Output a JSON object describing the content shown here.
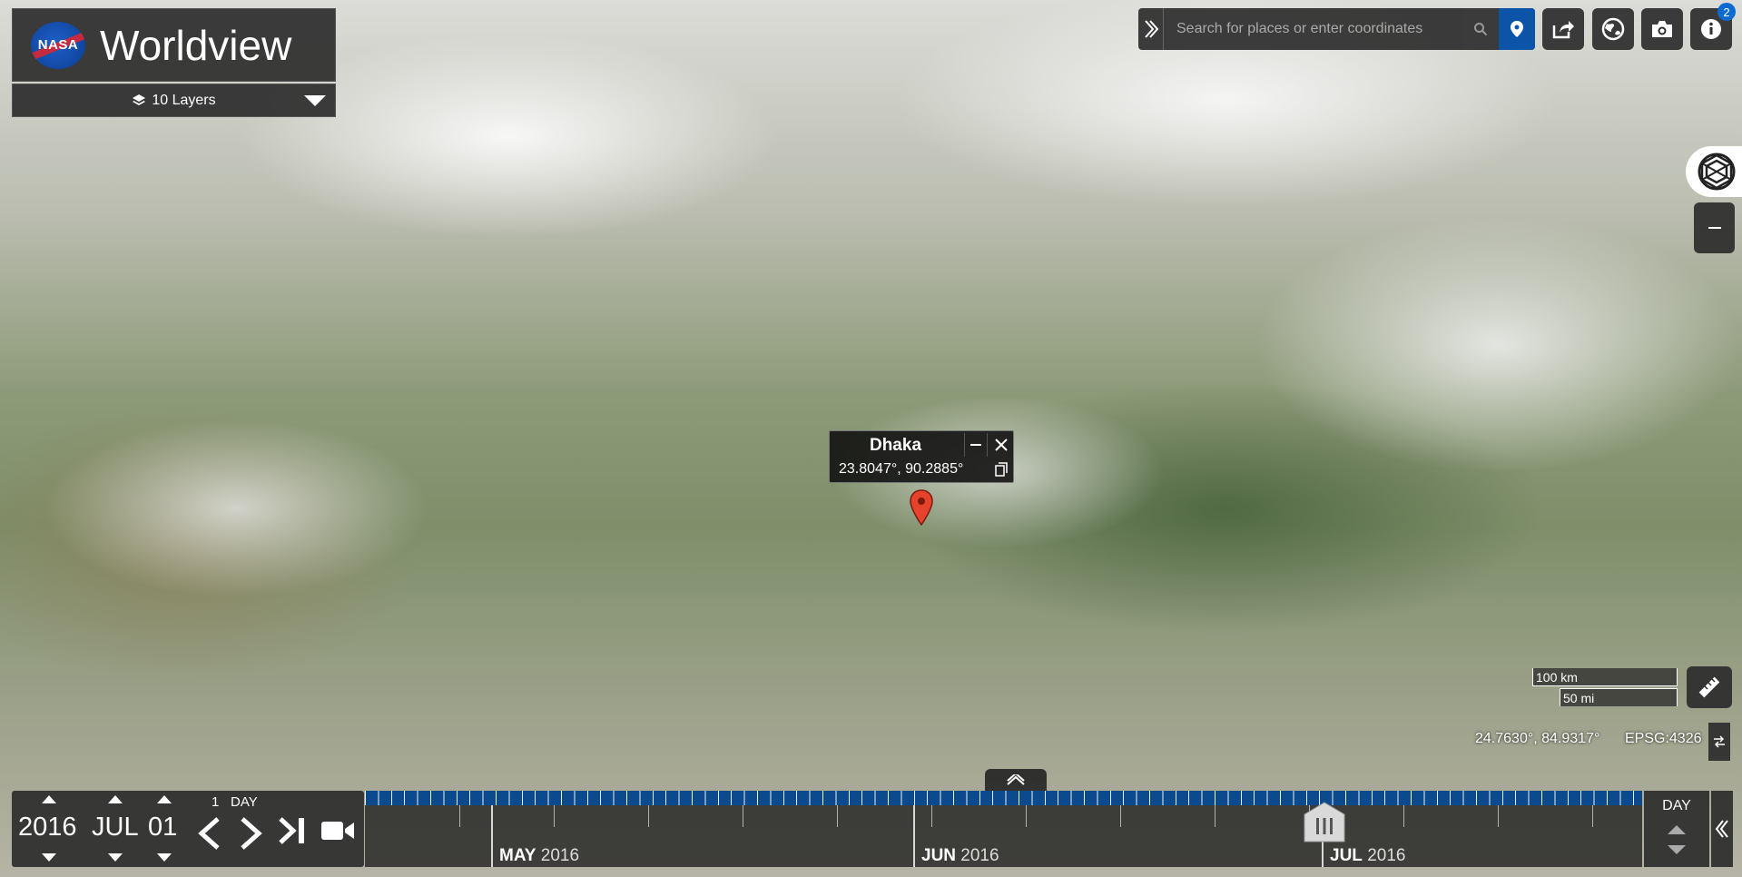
{
  "app": {
    "title": "Worldview",
    "logo_text": "NASA"
  },
  "layers": {
    "label": "10 Layers"
  },
  "search": {
    "placeholder": "Search for places or enter coordinates"
  },
  "toolbar": {
    "info_badge": "2"
  },
  "popup": {
    "title": "Dhaka",
    "coordinates": "23.8047°, 90.2885°"
  },
  "scale": {
    "km": "100 km",
    "mi": "50 mi"
  },
  "map": {
    "cursor_coordinates": "24.7630°, 84.9317°",
    "projection": "EPSG:4326"
  },
  "date": {
    "year": "2016",
    "month": "JUL",
    "day": "01"
  },
  "interval": {
    "num": "1",
    "unit": "DAY"
  },
  "timeline": {
    "months": [
      {
        "name": "MAY",
        "year": "2016"
      },
      {
        "name": "JUN",
        "year": "2016"
      },
      {
        "name": "JUL",
        "year": "2016"
      }
    ],
    "zoom_label": "DAY"
  },
  "colors": {
    "accent": "#0c54a8",
    "panel": "#2d2d2d",
    "marker": "#e5432c"
  },
  "icons": {
    "layers": "layers-icon",
    "search": "search-icon",
    "pin": "location-pin-icon",
    "share": "share-icon",
    "projection": "globe-icon",
    "snapshot": "camera-icon",
    "info": "info-icon"
  }
}
